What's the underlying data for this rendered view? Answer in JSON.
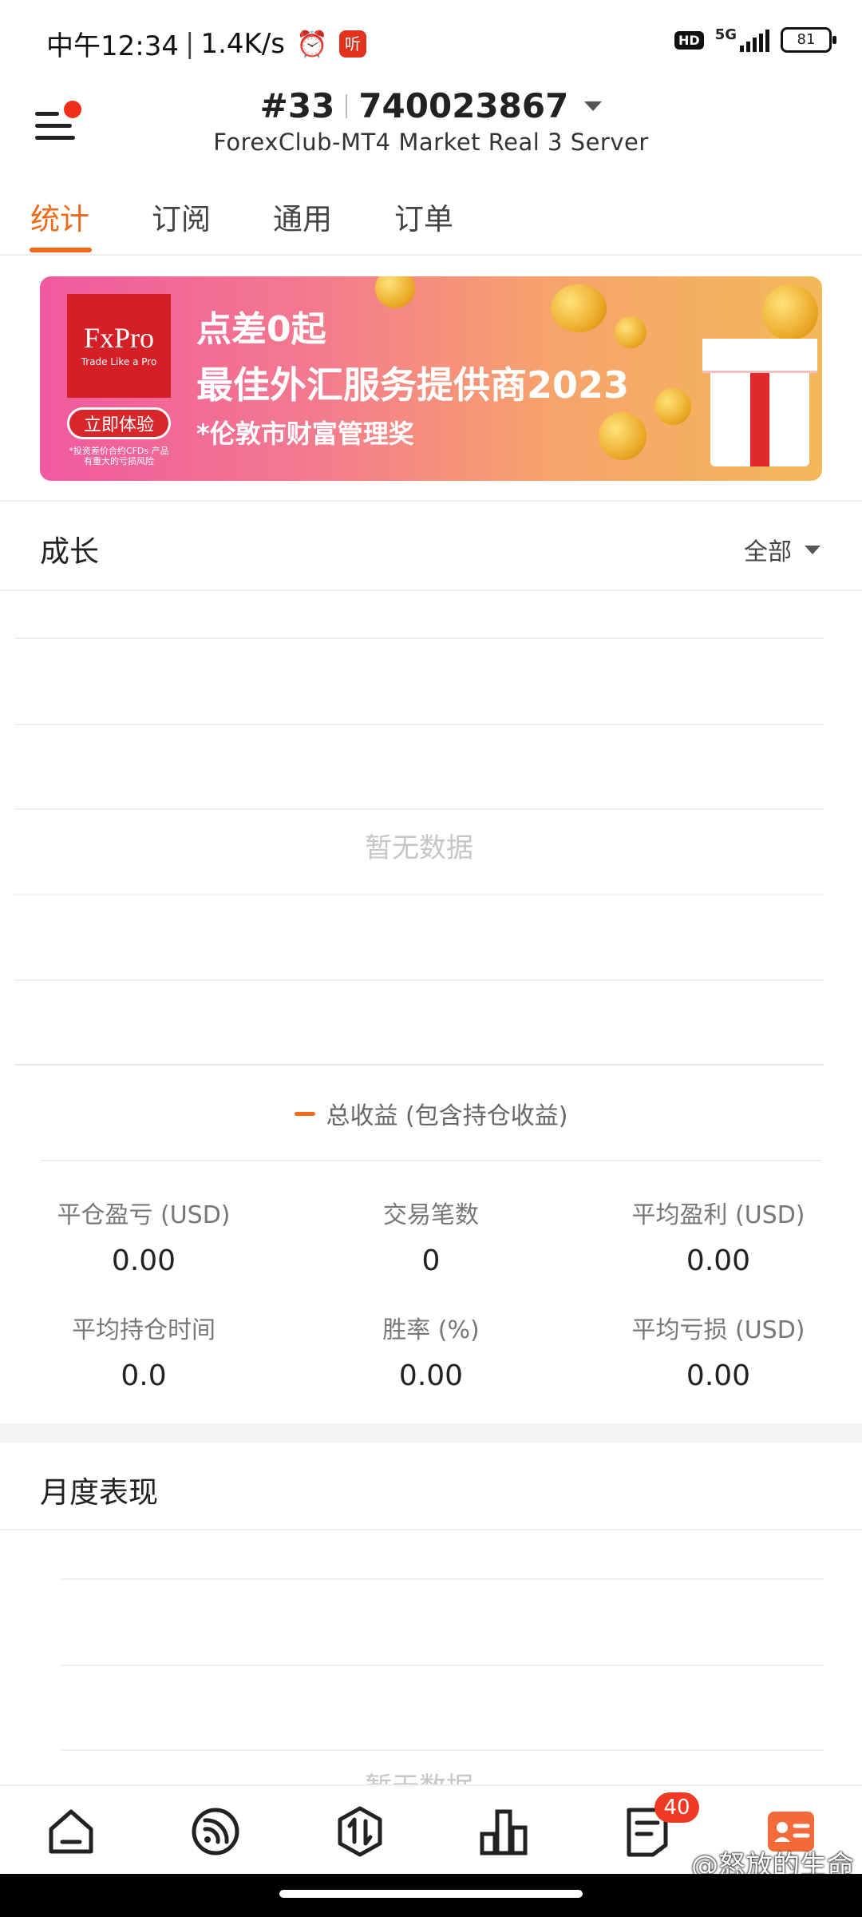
{
  "status_bar": {
    "time": "中午12:34",
    "speed": "1.4K/s",
    "app_badge": "听",
    "hd": "HD",
    "network": "5G",
    "battery": "81"
  },
  "header": {
    "account_prefix": "#33",
    "account_number": "740023867",
    "server": "ForexClub-MT4 Market Real 3 Server"
  },
  "tabs": [
    {
      "label": "统计",
      "active": true
    },
    {
      "label": "订阅",
      "active": false
    },
    {
      "label": "通用",
      "active": false
    },
    {
      "label": "订单",
      "active": false
    }
  ],
  "banner": {
    "brand": "FxPro",
    "tagline": "Trade Like a Pro",
    "cta": "立即体验",
    "warning": "*投资差价合约CFDs 产品有重大的亏损风险",
    "line1": "点差0起",
    "line2": "最佳外汇服务提供商2023",
    "line3": "*伦敦市财富管理奖"
  },
  "growth": {
    "title": "成长",
    "filter": "全部",
    "empty_text": "暂无数据",
    "legend": "总收益 (包含持仓收益)",
    "legend_color": "#f06a1a"
  },
  "stats": [
    {
      "label": "平仓盈亏 (USD)",
      "value": "0.00"
    },
    {
      "label": "交易笔数",
      "value": "0"
    },
    {
      "label": "平均盈利 (USD)",
      "value": "0.00"
    },
    {
      "label": "平均持仓时间",
      "value": "0.0"
    },
    {
      "label": "胜率 (%)",
      "value": "0.00"
    },
    {
      "label": "平均亏损 (USD)",
      "value": "0.00"
    }
  ],
  "monthly": {
    "title": "月度表现",
    "empty_text": "暂无数据"
  },
  "bottom_nav": {
    "items": [
      {
        "icon": "home-icon"
      },
      {
        "icon": "signal-feed-icon"
      },
      {
        "icon": "trade-icon"
      },
      {
        "icon": "chart-bars-icon"
      },
      {
        "icon": "document-icon"
      },
      {
        "icon": "profile-card-icon"
      }
    ],
    "badge": "40",
    "accent": "#f06a1a"
  },
  "watermark": "@怒放的生命"
}
